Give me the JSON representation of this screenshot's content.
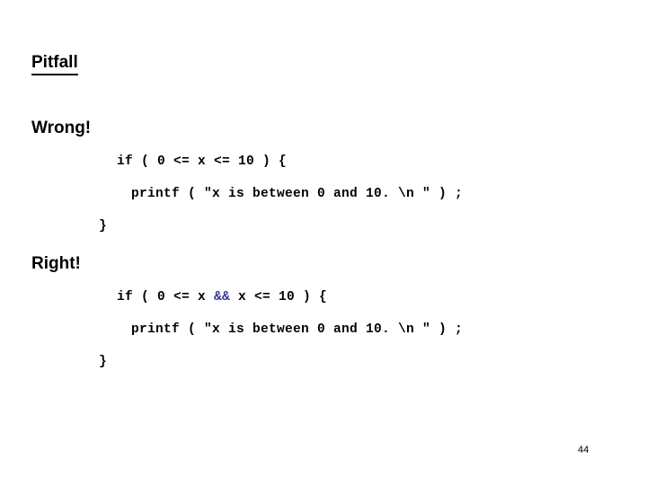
{
  "slide": {
    "title": "Pitfall",
    "page_number": "44",
    "accent_operator_color": "#333399",
    "text_color": "#000000",
    "background_color": "#ffffff"
  },
  "sections": {
    "wrong": {
      "heading": "Wrong!",
      "code": {
        "line1_if": "if ( 0 <= x <= 10 ) {",
        "line2_printf": "printf ( \"x is between 0 and 10. \\n \" ) ;",
        "line3_close": "}"
      }
    },
    "right": {
      "heading": "Right!",
      "code": {
        "line1_if_prefix": "if ( 0 <= x ",
        "line1_if_operator": "&&",
        "line1_if_suffix": " x <= 10 ) {",
        "line2_printf": "printf ( \"x is between 0 and 10. \\n \" ) ;",
        "line3_close": "}"
      }
    }
  }
}
